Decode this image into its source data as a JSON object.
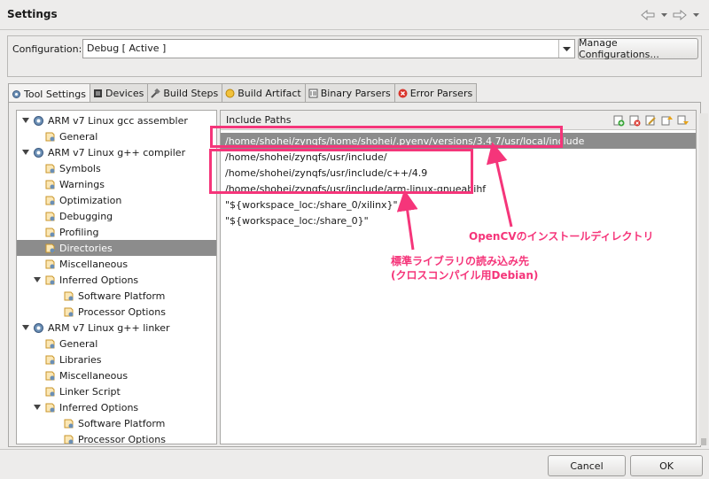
{
  "window": {
    "title": "Settings"
  },
  "configuration": {
    "label": "Configuration:",
    "value": "Debug  [ Active ]",
    "manage_label": "Manage Configurations..."
  },
  "tabs": [
    {
      "label": "Tool Settings",
      "active": true
    },
    {
      "label": "Devices"
    },
    {
      "label": "Build Steps"
    },
    {
      "label": "Build Artifact"
    },
    {
      "label": "Binary Parsers"
    },
    {
      "label": "Error Parsers"
    }
  ],
  "tree": [
    {
      "label": "ARM v7 Linux gcc assembler",
      "level": 0,
      "kind": "tool"
    },
    {
      "label": "General",
      "level": 1,
      "kind": "item"
    },
    {
      "label": "ARM v7 Linux g++ compiler",
      "level": 0,
      "kind": "tool"
    },
    {
      "label": "Symbols",
      "level": 1,
      "kind": "item"
    },
    {
      "label": "Warnings",
      "level": 1,
      "kind": "item"
    },
    {
      "label": "Optimization",
      "level": 1,
      "kind": "item"
    },
    {
      "label": "Debugging",
      "level": 1,
      "kind": "item"
    },
    {
      "label": "Profiling",
      "level": 1,
      "kind": "item"
    },
    {
      "label": "Directories",
      "level": 1,
      "kind": "item",
      "selected": true
    },
    {
      "label": "Miscellaneous",
      "level": 1,
      "kind": "item"
    },
    {
      "label": "Inferred Options",
      "level": 1,
      "kind": "folder"
    },
    {
      "label": "Software Platform",
      "level": 2,
      "kind": "item"
    },
    {
      "label": "Processor Options",
      "level": 2,
      "kind": "item"
    },
    {
      "label": "ARM v7 Linux g++ linker",
      "level": 0,
      "kind": "tool"
    },
    {
      "label": "General",
      "level": 1,
      "kind": "item"
    },
    {
      "label": "Libraries",
      "level": 1,
      "kind": "item"
    },
    {
      "label": "Miscellaneous",
      "level": 1,
      "kind": "item"
    },
    {
      "label": "Linker Script",
      "level": 1,
      "kind": "item"
    },
    {
      "label": "Inferred Options",
      "level": 1,
      "kind": "folder"
    },
    {
      "label": "Software Platform",
      "level": 2,
      "kind": "item"
    },
    {
      "label": "Processor Options",
      "level": 2,
      "kind": "item"
    }
  ],
  "include_paths": {
    "header": "Include Paths",
    "paths": [
      {
        "value": "/home/shohei/zynqfs/home/shohei/.pyenv/versions/3.4.7/usr/local/include",
        "selected": true
      },
      {
        "value": "/home/shohei/zynqfs/usr/include/"
      },
      {
        "value": "/home/shohei/zynqfs/usr/include/c++/4.9"
      },
      {
        "value": "/home/shohei/zynqfs/usr/include/arm-linux-gnueabihf"
      },
      {
        "value": "\"${workspace_loc:/share_0/xilinx}\""
      },
      {
        "value": "\"${workspace_loc:/share_0}\""
      }
    ]
  },
  "annotations": {
    "opencv": "OpenCVのインストールディレクトリ",
    "stdlib_line1": "標準ライブラリの読み込み先",
    "stdlib_line2": "(クロスコンパイル用Debian)",
    "color": "#f5357a"
  },
  "buttons": {
    "cancel": "Cancel",
    "ok": "OK"
  },
  "icons": {
    "nav_back": "arrow-left-icon",
    "nav_forward": "arrow-right-icon",
    "tree_tool": "gear-icon",
    "tree_item": "option-page-icon",
    "add": "add-icon",
    "delete": "delete-icon",
    "edit": "edit-icon",
    "move_up": "move-up-icon",
    "move_down": "move-down-icon"
  }
}
